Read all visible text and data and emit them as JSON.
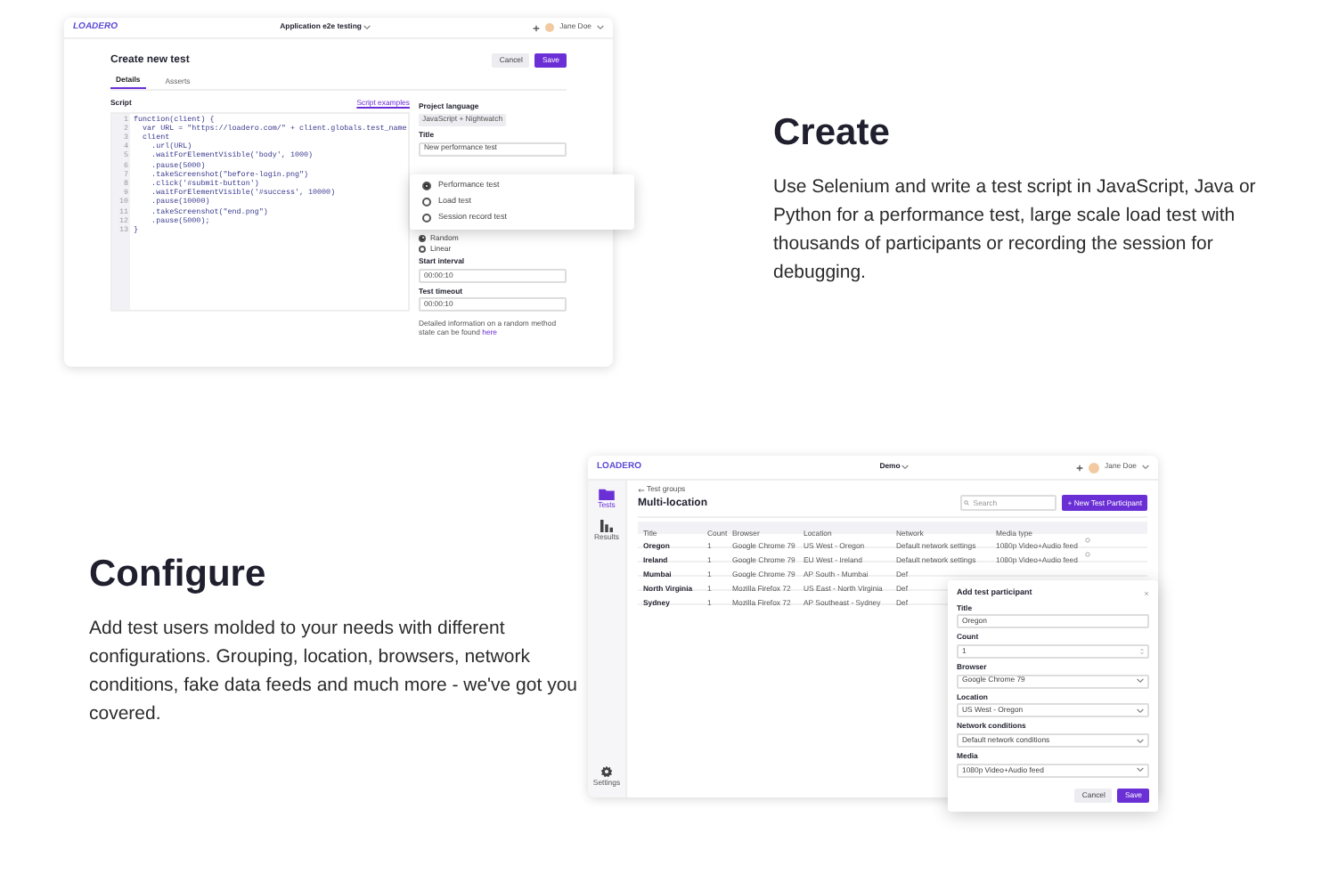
{
  "create_section": {
    "heading": "Create",
    "body": "Use Selenium and write a test script in JavaScript, Java or Python for a performance test, large scale load test with thousands of participants or recording the session for debugging."
  },
  "configure_section": {
    "heading": "Configure",
    "body": "Add test users molded to your needs with different configurations. Grouping, location, browsers, network conditions, fake data feeds and much more - we've got you covered."
  },
  "editor_app": {
    "logo": "LOADERO",
    "project": "Application e2e testing",
    "user": "Jane Doe",
    "page_title": "Create new test",
    "buttons": [
      {
        "label": "Cancel",
        "kind": "secondary"
      },
      {
        "label": "Save",
        "kind": "primary"
      }
    ],
    "tabs": [
      {
        "label": "Details",
        "selected": true
      },
      {
        "label": "Asserts",
        "selected": false
      }
    ],
    "script_label": "Script",
    "script_link": "Script examples",
    "code_lines": [
      {
        "number": "1",
        "text": "function(client) {"
      },
      {
        "number": "2",
        "text": "  var URL = \"https://loadero.com/\" + client.globals.test_name"
      },
      {
        "number": "3",
        "text": "  client"
      },
      {
        "number": "4",
        "text": "    .url(URL)"
      },
      {
        "number": "5",
        "text": "    .waitForElementVisible('body', 1000)"
      },
      {
        "number": "6",
        "text": "    .pause(5000)"
      },
      {
        "number": "7",
        "text": "    .takeScreenshot(\"before-login.png\")"
      },
      {
        "number": "8",
        "text": "    .click('#submit-button')"
      },
      {
        "number": "9",
        "text": "    .waitForElementVisible('#success', 10000)"
      },
      {
        "number": "10",
        "text": "    .pause(10000)"
      },
      {
        "number": "11",
        "text": "    .takeScreenshot(\"end.png\")"
      },
      {
        "number": "12",
        "text": "    .pause(5000);"
      },
      {
        "number": "13",
        "text": "}"
      }
    ],
    "form": {
      "language_label": "Project language",
      "language": "JavaScript + Nightwatch",
      "title_label": "Title",
      "title_value": "New performance test",
      "strategy_options": [
        {
          "label": "Random",
          "selected": true
        },
        {
          "label": "Linear",
          "selected": false
        }
      ],
      "start_label": "Start interval",
      "start_value": "00:00:10",
      "timeout_label": "Test timeout",
      "timeout_value": "00:00:10",
      "note": "Detailed information on a random method state can be found",
      "note_link": "here"
    },
    "test_type_menu": [
      {
        "label": "Performance test",
        "selected": true
      },
      {
        "label": "Load test",
        "selected": false
      },
      {
        "label": "Session record test",
        "selected": false
      }
    ]
  },
  "participants_app": {
    "logo": "LOADERO",
    "project": "Demo",
    "user": "Jane Doe",
    "sidebar": [
      {
        "label": "Tests",
        "kind": "folder",
        "selected": true
      },
      {
        "label": "Results",
        "kind": "chart",
        "selected": false
      },
      {
        "label": "Settings",
        "kind": "gear",
        "selected": false
      }
    ],
    "back_link": "Test groups",
    "page_title": "Multi-location",
    "search_placeholder": "Search",
    "new_button": "+ New Test Participant",
    "table": {
      "columns": [
        "Title",
        "Count",
        "Browser",
        "Location",
        "Network",
        "Media type"
      ],
      "rows": [
        [
          "Oregon",
          "1",
          "Google Chrome 79",
          "US West - Oregon",
          "Default network settings",
          "1080p Video+Audio feed"
        ],
        [
          "Ireland",
          "1",
          "Google Chrome 79",
          "EU West - Ireland",
          "Default network settings",
          "1080p Video+Audio feed"
        ],
        [
          "Mumbai",
          "1",
          "Google Chrome 79",
          "AP South - Mumbai",
          "Def"
        ],
        [
          "North Virginia",
          "1",
          "Mozilla Firefox 72",
          "US East - North Virginia",
          "Def"
        ],
        [
          "Sydney",
          "1",
          "Mozilla Firefox 72",
          "AP Southeast - Sydney",
          "Def"
        ]
      ]
    },
    "modal": {
      "title": "Add test participant",
      "fields": [
        {
          "label": "Title",
          "value": "Oregon",
          "kind": "text"
        },
        {
          "label": "Count",
          "value": "1",
          "kind": "number"
        },
        {
          "label": "Browser",
          "value": "Google Chrome 79",
          "kind": "select"
        },
        {
          "label": "Location",
          "value": "US West - Oregon",
          "kind": "select"
        },
        {
          "label": "Network conditions",
          "value": "Default network conditions",
          "kind": "select"
        },
        {
          "label": "Media",
          "value": "1080p Video+Audio feed",
          "kind": "select"
        }
      ],
      "buttons": [
        {
          "label": "Cancel",
          "kind": "secondary"
        },
        {
          "label": "Save",
          "kind": "primary"
        }
      ]
    }
  }
}
